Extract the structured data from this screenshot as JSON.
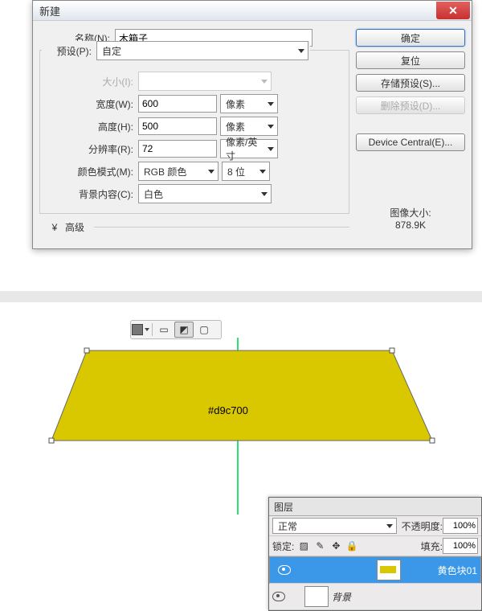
{
  "dialog": {
    "title": "新建",
    "name_label": "名称(N):",
    "name_value": "木箱子",
    "preset_label": "预设(P):",
    "preset_value": "自定",
    "size_label": "大小(I):",
    "width_label": "宽度(W):",
    "width_value": "600",
    "width_unit": "像素",
    "height_label": "高度(H):",
    "height_value": "500",
    "height_unit": "像素",
    "res_label": "分辨率(R):",
    "res_value": "72",
    "res_unit": "像素/英寸",
    "mode_label": "颜色模式(M):",
    "mode_value": "RGB 颜色",
    "depth_value": "8 位",
    "bg_label": "背景内容(C):",
    "bg_value": "白色",
    "advanced_label": "高级",
    "buttons": {
      "ok": "确定",
      "reset": "复位",
      "save_preset": "存储预设(S)...",
      "delete_preset": "删除预设(D)...",
      "device_central": "Device Central(E)..."
    },
    "info_label": "图像大小:",
    "info_value": "878.9K"
  },
  "shape": {
    "color_label": "#d9c700",
    "fill_hex": "#d9c700"
  },
  "layers": {
    "tab": "图层",
    "blend_label": "正常",
    "opacity_label": "不透明度:",
    "opacity_value": "100%",
    "lock_label": "锁定:",
    "fill_label": "填充:",
    "fill_value": "100%",
    "items": [
      {
        "name": "黄色块01",
        "selected": true
      },
      {
        "name": "背景",
        "selected": false
      }
    ]
  }
}
